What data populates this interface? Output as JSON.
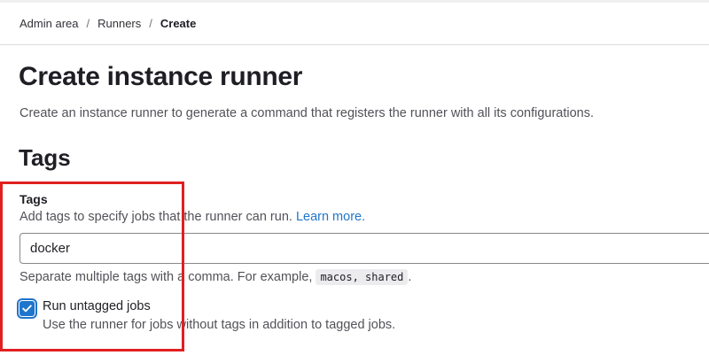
{
  "breadcrumb": {
    "items": [
      "Admin area",
      "Runners",
      "Create"
    ],
    "separator": "/"
  },
  "page": {
    "title": "Create instance runner",
    "description": "Create an instance runner to generate a command that registers the runner with all its configurations."
  },
  "tags_section": {
    "title": "Tags",
    "field_label": "Tags",
    "help_text": "Add tags to specify jobs that the runner can run.",
    "learn_more": "Learn more.",
    "input_value": "docker",
    "hint_prefix": "Separate multiple tags with a comma. For example,",
    "hint_example": "macos, shared",
    "hint_suffix": ".",
    "checkbox_label": "Run untagged jobs",
    "checkbox_checked": true,
    "checkbox_help": "Use the runner for jobs without tags in addition to tagged jobs."
  },
  "colors": {
    "accent": "#1f75cb",
    "highlight": "#e02020"
  },
  "icons": {
    "checkbox": "checkmark-icon"
  }
}
